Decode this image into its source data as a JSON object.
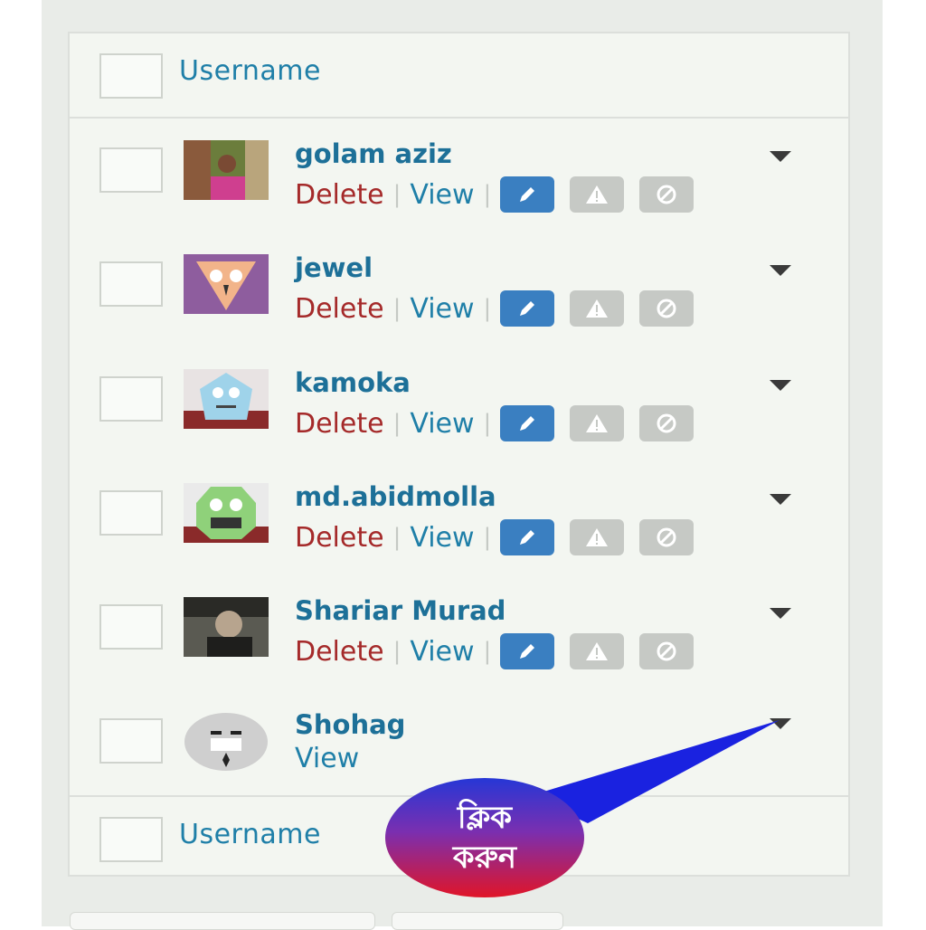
{
  "header": {
    "column_label": "Username"
  },
  "footer": {
    "column_label": "Username"
  },
  "users": [
    {
      "name": "golam aziz",
      "delete": "Delete",
      "view": "View",
      "avatar": "photo-avatar-pink",
      "actions": [
        "edit-icon",
        "warning-icon",
        "ban-icon"
      ]
    },
    {
      "name": "jewel",
      "delete": "Delete",
      "view": "View",
      "avatar": "cartoon-avatar-purple",
      "actions": [
        "edit-icon",
        "warning-icon",
        "ban-icon"
      ]
    },
    {
      "name": "kamoka",
      "delete": "Delete",
      "view": "View",
      "avatar": "cartoon-avatar-blue",
      "actions": [
        "edit-icon",
        "warning-icon",
        "ban-icon"
      ]
    },
    {
      "name": "md.abidmolla",
      "delete": "Delete",
      "view": "View",
      "avatar": "cartoon-avatar-green",
      "actions": [
        "edit-icon",
        "warning-icon",
        "ban-icon"
      ]
    },
    {
      "name": "Shariar Murad",
      "delete": "Delete",
      "view": "View",
      "avatar": "photo-avatar-dark",
      "actions": [
        "edit-icon",
        "warning-icon",
        "ban-icon"
      ]
    },
    {
      "name": "Shohag",
      "view": "View",
      "avatar": "default-avatar-grey"
    }
  ],
  "annotation": {
    "line1": "ক্লিক",
    "line2": "করুন"
  },
  "colors": {
    "link": "#1f7fa8",
    "delete": "#a52a2a",
    "edit_button": "#3a7fc1",
    "disabled_button": "#c6c9c5"
  }
}
